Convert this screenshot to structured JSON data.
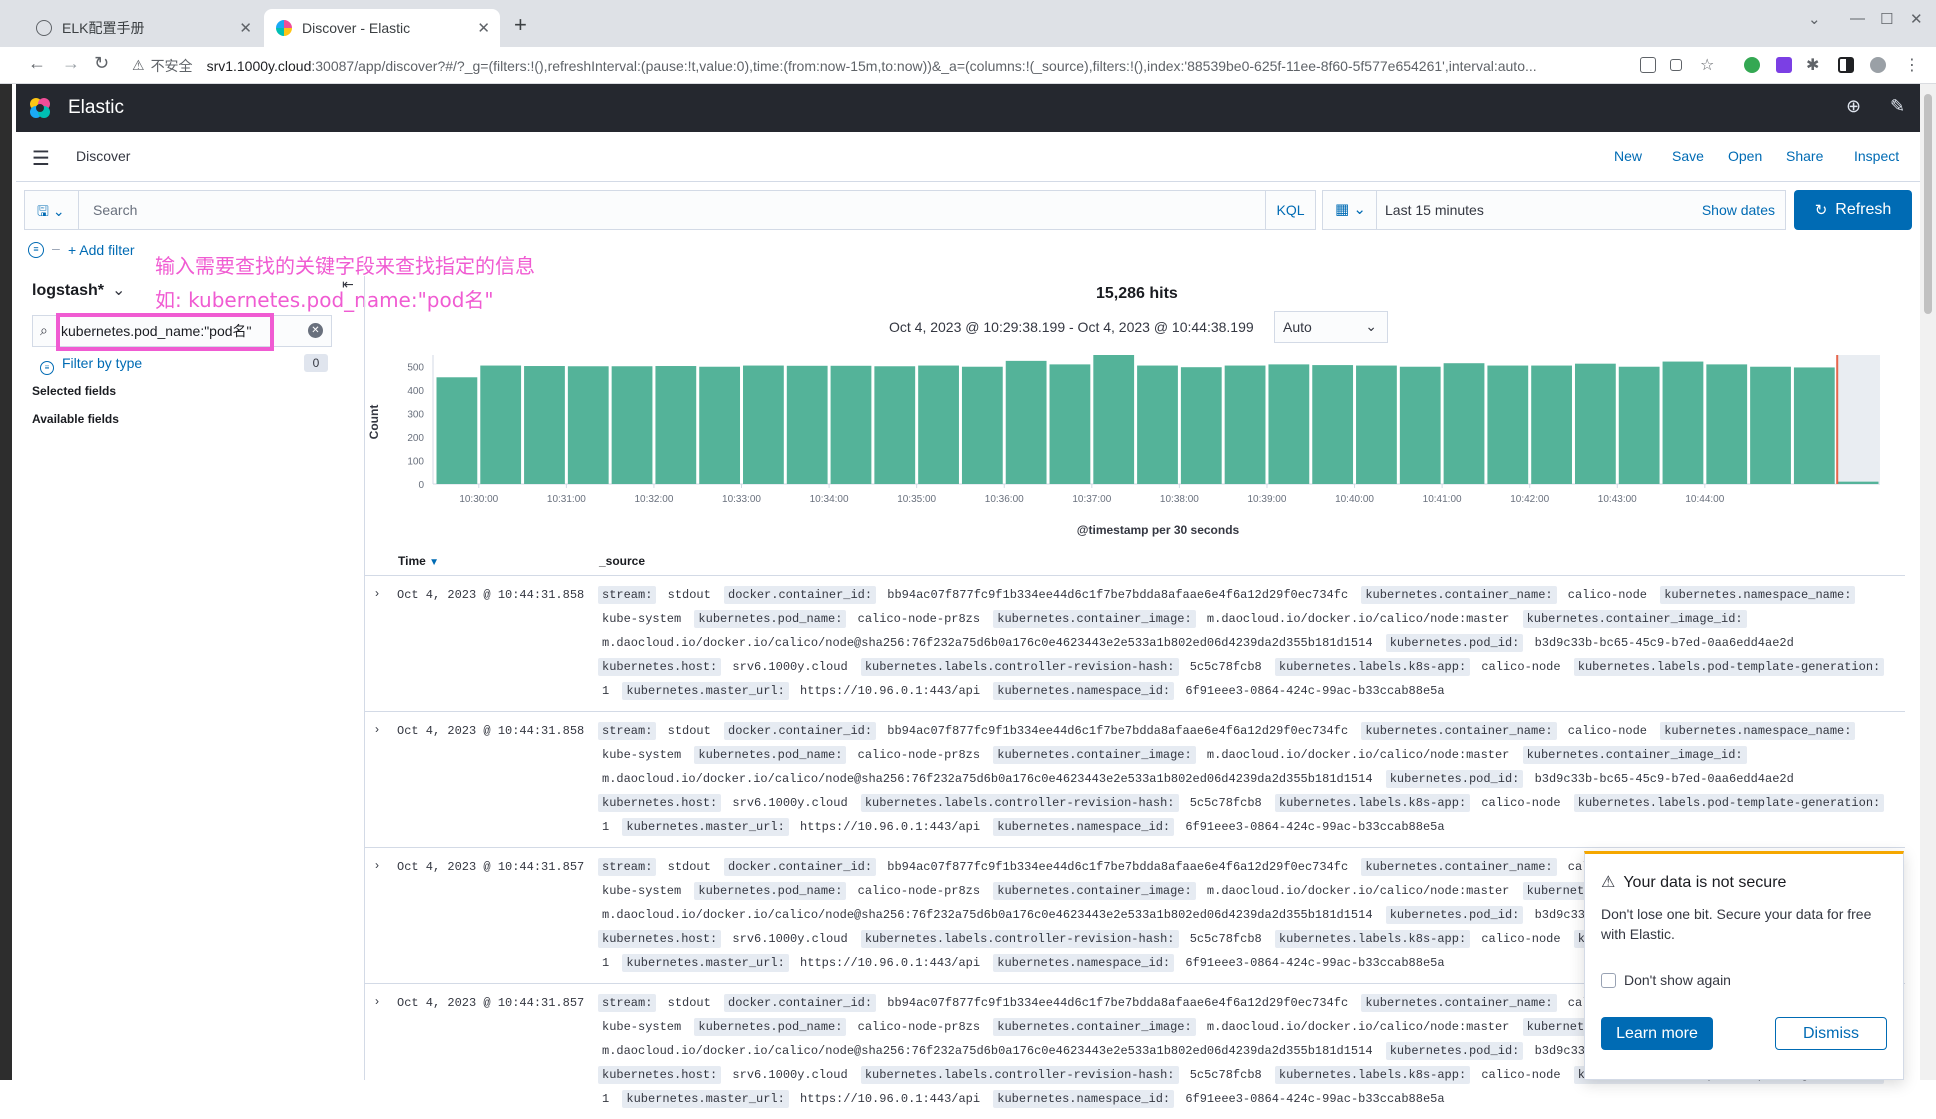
{
  "browser": {
    "tabs": [
      {
        "title": "ELK配置手册"
      },
      {
        "title": "Discover - Elastic"
      }
    ],
    "insecure_label": "不安全",
    "url_host": "srv1.1000y.cloud",
    "url_path": ":30087/app/discover?#/?_g=(filters:!(),refreshInterval:(pause:!t,value:0),time:(from:now-15m,to:now))&_a=(columns:!(_source),filters:!(),index:'88539be0-625f-11ee-8f60-5f577e654261',interval:auto..."
  },
  "kibana": {
    "brand": "Elastic",
    "app_title": "Discover",
    "top_links": [
      "New",
      "Save",
      "Open",
      "Share",
      "Inspect"
    ]
  },
  "query": {
    "placeholder": "Search",
    "language": "KQL",
    "date_range": "Last 15 minutes",
    "show_dates": "Show dates",
    "refresh": "Refresh",
    "add_filter": "+ Add filter"
  },
  "annotation": {
    "line1": "输入需要查找的关键字段来查找指定的信息",
    "line2": "如: kubernetes.pod_name:\"pod名\""
  },
  "sidebar": {
    "index_pattern": "logstash*",
    "field_search_value": "kubernetes.pod_name:\"pod名\"",
    "filter_by_type": "Filter by type",
    "filter_count": "0",
    "selected_fields": "Selected fields",
    "available_fields": "Available fields"
  },
  "results": {
    "hits": "15,286 hits",
    "time_range": "Oct 4, 2023 @ 10:29:38.199 - Oct 4, 2023 @ 10:44:38.199",
    "interval": "Auto",
    "col_time": "Time",
    "col_source": "_source"
  },
  "chart_data": {
    "type": "bar",
    "ylabel": "Count",
    "xlabel": "@timestamp per 30 seconds",
    "ylim": [
      0,
      550
    ],
    "yticks": [
      0,
      100,
      200,
      300,
      400,
      500
    ],
    "xticks": [
      "10:30:00",
      "10:31:00",
      "10:32:00",
      "10:33:00",
      "10:34:00",
      "10:35:00",
      "10:36:00",
      "10:37:00",
      "10:38:00",
      "10:39:00",
      "10:40:00",
      "10:41:00",
      "10:42:00",
      "10:43:00",
      "10:44:00"
    ],
    "values": [
      455,
      505,
      503,
      502,
      502,
      503,
      500,
      505,
      504,
      504,
      502,
      505,
      500,
      525,
      510,
      550,
      505,
      498,
      505,
      510,
      507,
      505,
      500,
      515,
      505,
      505,
      513,
      500,
      522,
      510,
      500,
      497,
      10
    ],
    "colors": {
      "bar": "#54b399",
      "marker": "#e7664c"
    }
  },
  "documents": [
    {
      "time": "Oct 4, 2023 @ 10:44:31.858"
    },
    {
      "time": "Oct 4, 2023 @ 10:44:31.858"
    },
    {
      "time": "Oct 4, 2023 @ 10:44:31.857"
    },
    {
      "time": "Oct 4, 2023 @ 10:44:31.857"
    }
  ],
  "source_fields": [
    {
      "k": "stream:",
      "v": "stdout"
    },
    {
      "k": "docker.container_id:",
      "v": "bb94ac07f877fc9f1b334ee44d6c1f7be7bdda8afaae6e4f6a12d29f0ec734fc"
    },
    {
      "k": "kubernetes.container_name:",
      "v": "calico-node"
    },
    {
      "k": "kubernetes.namespace_name:",
      "v": "kube-system"
    },
    {
      "k": "kubernetes.pod_name:",
      "v": "calico-node-pr8zs"
    },
    {
      "k": "kubernetes.container_image:",
      "v": "m.daocloud.io/docker.io/calico/node:master"
    },
    {
      "k": "kubernetes.container_image_id:",
      "v": "m.daocloud.io/docker.io/calico/node@sha256:76f232a75d6b0a176c0e4623443e2e533a1b802ed06d4239da2d355b181d1514"
    },
    {
      "k": "kubernetes.pod_id:",
      "v": "b3d9c33b-bc65-45c9-b7ed-0aa6edd4ae2d"
    },
    {
      "k": "kubernetes.host:",
      "v": "srv6.1000y.cloud"
    },
    {
      "k": "kubernetes.labels.controller-revision-hash:",
      "v": "5c5c78fcb8"
    },
    {
      "k": "kubernetes.labels.k8s-app:",
      "v": "calico-node"
    },
    {
      "k": "kubernetes.labels.pod-template-generation:",
      "v": "1"
    },
    {
      "k": "kubernetes.master_url:",
      "v": "https://10.96.0.1:443/api"
    },
    {
      "k": "kubernetes.namespace_id:",
      "v": "6f91eee3-0864-424c-99ac-b33ccab88e5a"
    }
  ],
  "toast": {
    "title": "Your data is not secure",
    "body": "Don't lose one bit. Secure your data for free with Elastic.",
    "checkbox": "Don't show again",
    "learn_more": "Learn more",
    "dismiss": "Dismiss"
  }
}
